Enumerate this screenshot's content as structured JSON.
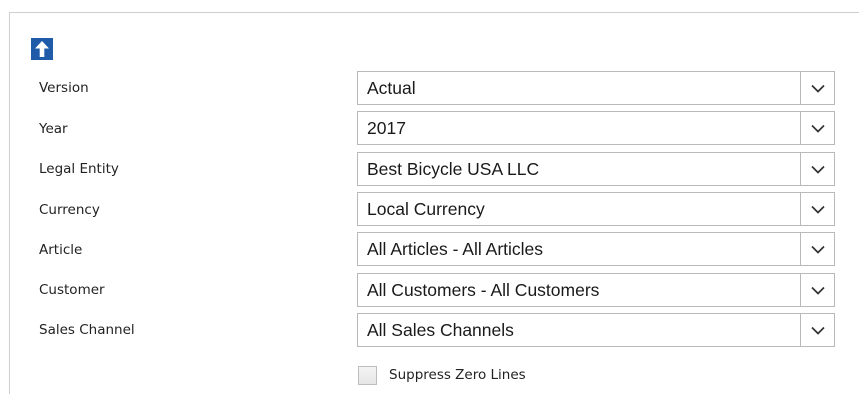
{
  "toolbar": {
    "up_icon": "arrow-up-icon",
    "accent_color": "#1f5ba8"
  },
  "filters": [
    {
      "label": "Version",
      "value": "Actual"
    },
    {
      "label": "Year",
      "value": "2017"
    },
    {
      "label": "Legal Entity",
      "value": "Best Bicycle USA LLC"
    },
    {
      "label": "Currency",
      "value": "Local Currency"
    },
    {
      "label": "Article",
      "value": "All Articles - All Articles"
    },
    {
      "label": "Customer",
      "value": "All Customers - All Customers"
    },
    {
      "label": "Sales Channel",
      "value": "All Sales Channels"
    }
  ],
  "dropdown_icon": "chevron-down-icon",
  "suppress_zero": {
    "label": "Suppress Zero Lines",
    "checked": false
  }
}
